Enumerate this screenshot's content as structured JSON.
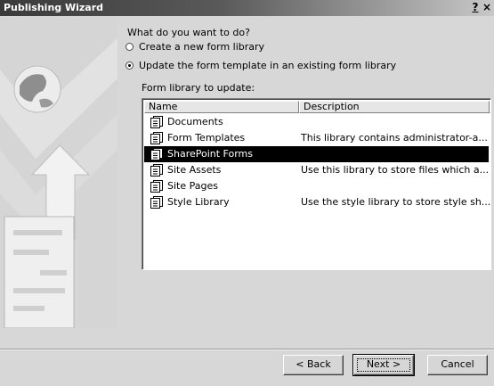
{
  "window": {
    "title": "Publishing Wizard",
    "help_label": "?",
    "close_label": "×"
  },
  "question": "What do you want to do?",
  "options": [
    {
      "label": "Create a new form library",
      "selected": false
    },
    {
      "label": "Update the form template in an existing form library",
      "selected": true
    }
  ],
  "library_label": "Form library to update:",
  "list": {
    "columns": [
      "Name",
      "Description"
    ],
    "rows": [
      {
        "name": "Documents",
        "description": "",
        "selected": false
      },
      {
        "name": "Form Templates",
        "description": "This library contains administrator-a...",
        "selected": false
      },
      {
        "name": "SharePoint Forms",
        "description": "",
        "selected": true
      },
      {
        "name": "Site Assets",
        "description": "Use this library to store files which a...",
        "selected": false
      },
      {
        "name": "Site Pages",
        "description": "",
        "selected": false
      },
      {
        "name": "Style Library",
        "description": "Use the style library to store style sh...",
        "selected": false
      }
    ]
  },
  "buttons": {
    "back": "< Back",
    "next": "Next >",
    "cancel": "Cancel"
  },
  "icons": {
    "row_icon": "form-library-icon",
    "side_art": "globe-upload-art"
  },
  "colors": {
    "selection": "#000000",
    "window_bg": "#d7d7d7",
    "title_dark": "#3a3a3a"
  }
}
